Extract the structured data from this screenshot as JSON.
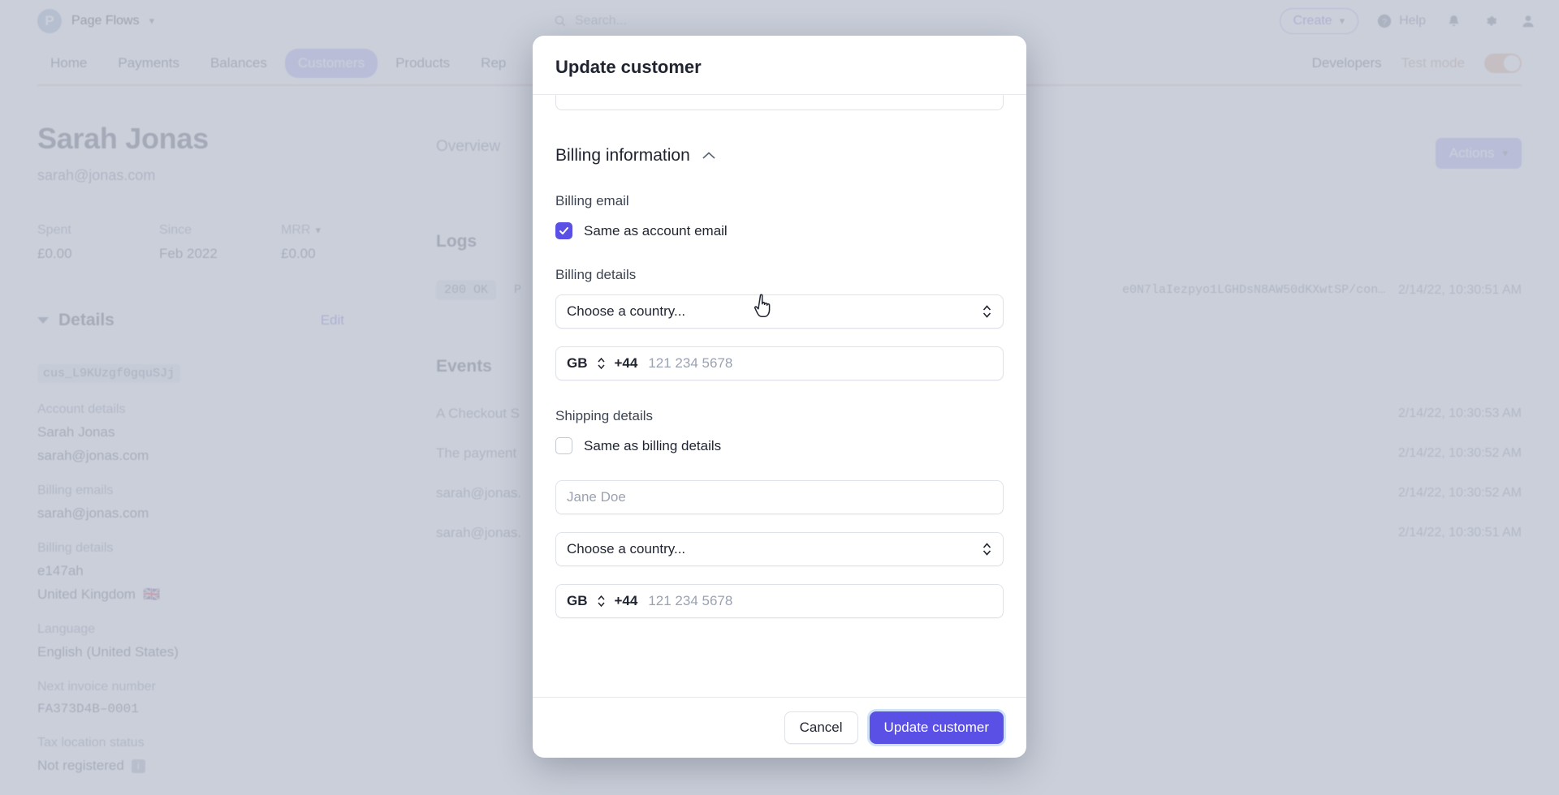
{
  "topbar": {
    "brand_initial": "P",
    "brand_name": "Page Flows",
    "search_placeholder": "Search...",
    "create_label": "Create",
    "help_label": "Help",
    "icons": [
      "search-icon",
      "question-circle-icon",
      "bell-icon",
      "gear-icon",
      "user-avatar-icon"
    ]
  },
  "nav": {
    "items": [
      {
        "label": "Home",
        "active": false
      },
      {
        "label": "Payments",
        "active": false
      },
      {
        "label": "Balances",
        "active": false
      },
      {
        "label": "Customers",
        "active": true
      },
      {
        "label": "Products",
        "active": false
      },
      {
        "label": "Rep",
        "active": false
      }
    ],
    "developers_label": "Developers",
    "test_mode_label": "Test mode",
    "test_mode_on": true
  },
  "customer": {
    "name": "Sarah Jonas",
    "email": "sarah@jonas.com",
    "stats": [
      {
        "label": "Spent",
        "value": "£0.00"
      },
      {
        "label": "Since",
        "value": "Feb 2022"
      },
      {
        "label": "MRR",
        "value": "£0.00",
        "has_chevron": true
      }
    ],
    "details_title": "Details",
    "edit_label": "Edit",
    "customer_id": "cus_L9KUzgf0gquSJj",
    "fields": [
      {
        "label": "Account details",
        "values": [
          "Sarah Jonas",
          "sarah@jonas.com"
        ]
      },
      {
        "label": "Billing emails",
        "values": [
          "sarah@jonas.com"
        ]
      },
      {
        "label": "Billing details",
        "values": [
          "e147ah",
          "United Kingdom"
        ],
        "flag": "🇬🇧"
      },
      {
        "label": "Language",
        "values": [
          "English (United States)"
        ]
      },
      {
        "label": "Next invoice number",
        "values": [
          "FA373D4B–0001"
        ],
        "mono": true
      },
      {
        "label": "Tax location status",
        "values": [
          "Not registered"
        ],
        "info": true
      }
    ]
  },
  "main": {
    "tabs": [
      {
        "label": "Overview"
      }
    ],
    "actions_label": "Actions",
    "logs_title": "Logs",
    "logs": [
      {
        "status": "200 OK",
        "text": "P",
        "url": "e0N7laIezpyo1LGHDsN8AW50dKXwtSP/con…",
        "time": "2/14/22, 10:30:51 AM"
      }
    ],
    "events_title": "Events",
    "events": [
      {
        "text": "A Checkout S",
        "time": "2/14/22, 10:30:53 AM"
      },
      {
        "text": "The payment",
        "time": "2/14/22, 10:30:52 AM"
      },
      {
        "text": "sarah@jonas.",
        "time": "2/14/22, 10:30:52 AM"
      },
      {
        "text": "sarah@jonas.",
        "time": "2/14/22, 10:30:51 AM"
      }
    ]
  },
  "modal": {
    "title": "Update customer",
    "billing_section_title": "Billing information",
    "billing_email_label": "Billing email",
    "same_as_account_email_label": "Same as account email",
    "same_as_account_email_checked": true,
    "billing_details_label": "Billing details",
    "billing_country_value": "Choose a country...",
    "billing_phone_country": "GB",
    "billing_phone_dial": "+44",
    "billing_phone_placeholder": "121 234 5678",
    "shipping_details_label": "Shipping details",
    "same_as_billing_label": "Same as billing details",
    "same_as_billing_checked": false,
    "shipping_name_placeholder": "Jane Doe",
    "shipping_country_value": "Choose a country...",
    "shipping_phone_country": "GB",
    "shipping_phone_dial": "+44",
    "shipping_phone_placeholder": "121 234 5678",
    "cancel_label": "Cancel",
    "submit_label": "Update customer"
  },
  "colors": {
    "accent": "#5b50e5",
    "nav_active": "#a79df0",
    "test_mode": "#c08b6e",
    "link": "#6257d6"
  }
}
